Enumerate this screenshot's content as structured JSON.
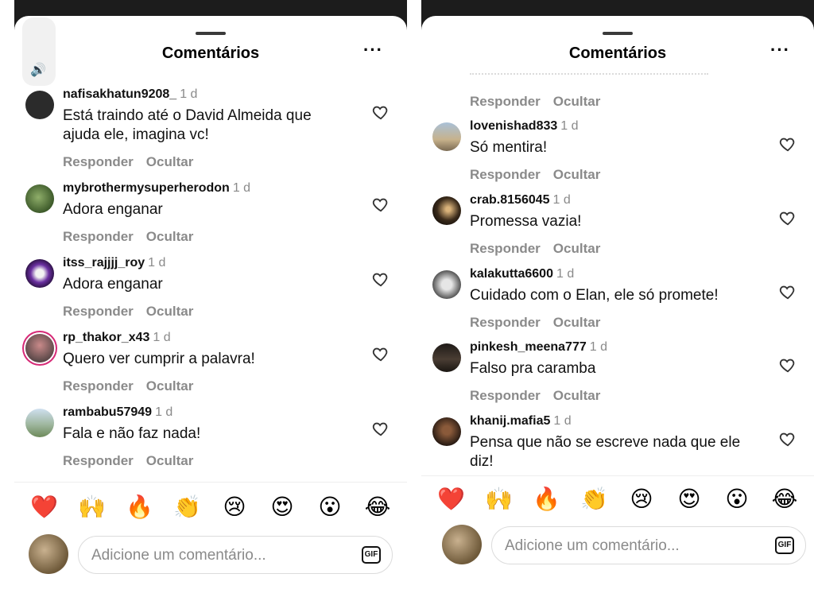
{
  "title": "Comentários",
  "more_label": "···",
  "reply_label": "Responder",
  "hide_label": "Ocultar",
  "input_placeholder": "Adicione um comentário...",
  "gif_label": "GIF",
  "emojis": [
    "❤️",
    "🙌",
    "🔥",
    "👏",
    "😢",
    "😍",
    "😮",
    "😂"
  ],
  "left_comments": [
    {
      "user": "nafisakhatun9208_",
      "age": "1 d",
      "text": "Está traindo até o David Almeida que ajuda ele, imagina vc!"
    },
    {
      "user": "mybrothermysuperherodon",
      "age": "1 d",
      "text": "Adora enganar"
    },
    {
      "user": "itss_rajjjj_roy",
      "age": "1 d",
      "text": "Adora enganar"
    },
    {
      "user": "rp_thakor_x43",
      "age": "1 d",
      "text": "Quero ver cumprir a palavra!"
    },
    {
      "user": "rambabu57949",
      "age": "1 d",
      "text": "Fala e não faz nada!"
    }
  ],
  "right_comments": [
    {
      "user": "lovenishad833",
      "age": "1 d",
      "text": "Só mentira!"
    },
    {
      "user": "crab.8156045",
      "age": "1 d",
      "text": "Promessa vazia!"
    },
    {
      "user": "kalakutta6600",
      "age": "1 d",
      "text": "Cuidado com o Elan, ele só promete!"
    },
    {
      "user": "pinkesh_meena777",
      "age": "1 d",
      "text": "Falso pra caramba"
    },
    {
      "user": "khanij.mafia5",
      "age": "1 d",
      "text": "Pensa que não se escreve nada que ele diz!"
    }
  ]
}
